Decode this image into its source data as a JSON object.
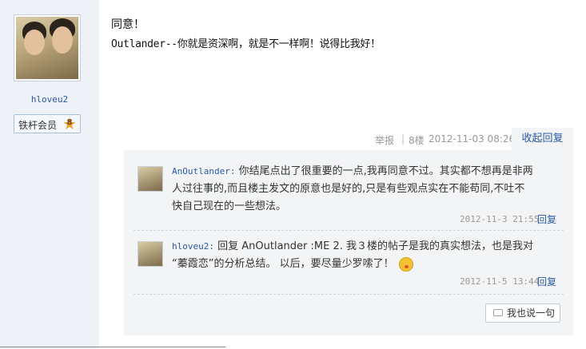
{
  "user": {
    "username": "hloveu2",
    "badge_label": "铁杆会员",
    "badge_level": "8"
  },
  "post": {
    "title": "同意！",
    "body": "Outlander--你就是资深啊，就是不一样啊！说得比我好！"
  },
  "meta": {
    "report": "举报",
    "separator": "|",
    "floor": "8楼",
    "date": "2012-11-03 08:26",
    "collapse_reply": "收起回复"
  },
  "comments": [
    {
      "name": "AnOutlander:",
      "line1": "你结尾点出了很重要的一点,我再同意不过。其实都不想再是非两",
      "line2": "人过往事的,而且楼主发文的原意也是好的,只是有些观点实在不能苟同,不吐不",
      "line3": "快自己现在的一些想法。",
      "time": "2012-11-3 21:55",
      "reply": "回复"
    },
    {
      "name": "hloveu2:",
      "line1": "回复 AnOutlander :ME 2. 我３楼的帖子是我的真实想法，也是我对",
      "line2": "“蓁霞恋”的分析总结。 以后，要尽量少罗嗦了！",
      "emoji": "smile-blush-icon",
      "time": "2012-11-5 13:44",
      "reply": "回复"
    }
  ],
  "say_button": "我也说一句",
  "colors": {
    "link": "#2a5aa5",
    "left_panel": "#eef1f5",
    "comment_bg": "#f2f4f6",
    "badge_star": "#e7a62a"
  }
}
